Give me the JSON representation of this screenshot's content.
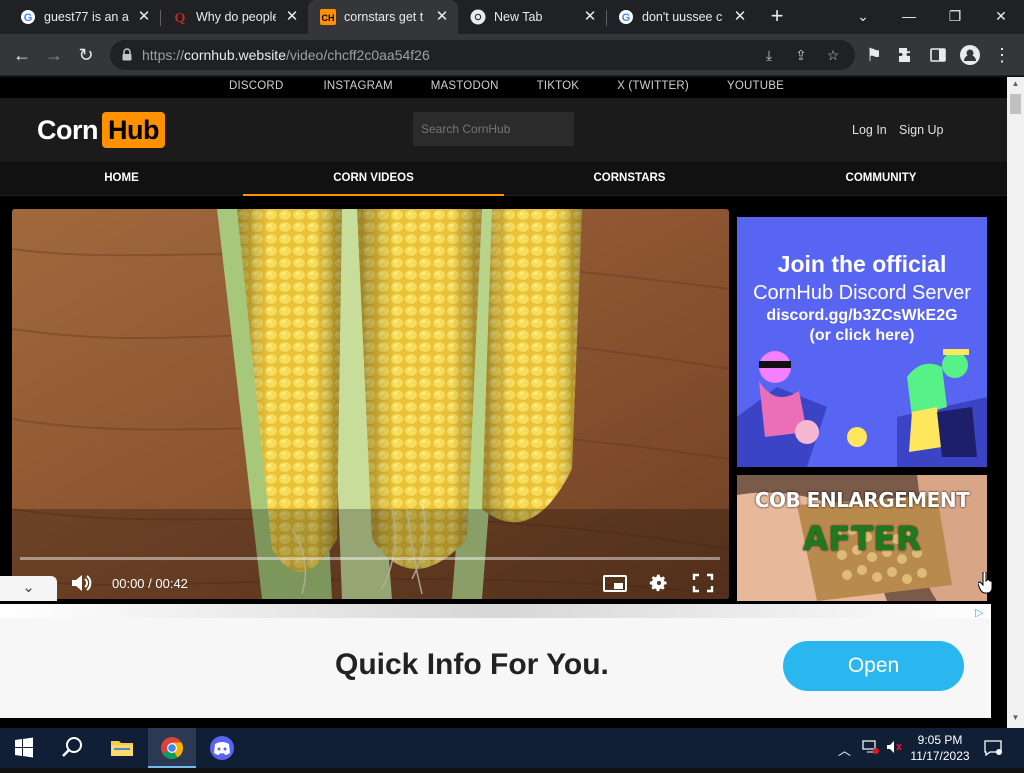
{
  "browser": {
    "tabs": [
      {
        "title": "guest77 is an a",
        "favicon": "google-icon",
        "active": false
      },
      {
        "title": "Why do people",
        "favicon": "quora-icon",
        "active": false
      },
      {
        "title": "cornstars get tr",
        "favicon": "cornhub-icon",
        "active": true
      },
      {
        "title": "New Tab",
        "favicon": "chrome-icon",
        "active": false
      },
      {
        "title": "don't uussee c",
        "favicon": "google-icon",
        "active": false
      }
    ],
    "url_host": "cornhub.website",
    "url_path": "/video/chcff2c0aa54f26",
    "url_scheme": "https://"
  },
  "site": {
    "social_links": [
      "DISCORD",
      "INSTAGRAM",
      "MASTODON",
      "TIKTOK",
      "X (TWITTER)",
      "YOUTUBE"
    ],
    "logo_left": "Corn",
    "logo_right": "Hub",
    "search_placeholder": "Search CornHub",
    "login": "Log In",
    "signup": "Sign Up",
    "nav": [
      "HOME",
      "CORN VIDEOS",
      "CORNSTARS",
      "COMMUNITY"
    ],
    "nav_active": "CORN VIDEOS",
    "accent": "#ff9000"
  },
  "video": {
    "time": "00:00 / 00:42",
    "progress": 0
  },
  "ads": {
    "discord": {
      "line1": "Join the official",
      "line2": "CornHub Discord Server",
      "line3": "discord.gg/b3ZCsWkE2G",
      "line4": "(or click here)"
    },
    "cob": {
      "line1": "COB ENLARGEMENT",
      "line2": "AFTER"
    },
    "banner": {
      "headline": "Quick Info For You.",
      "button": "Open"
    }
  },
  "taskbar": {
    "time": "9:05 PM",
    "date": "11/17/2023"
  }
}
